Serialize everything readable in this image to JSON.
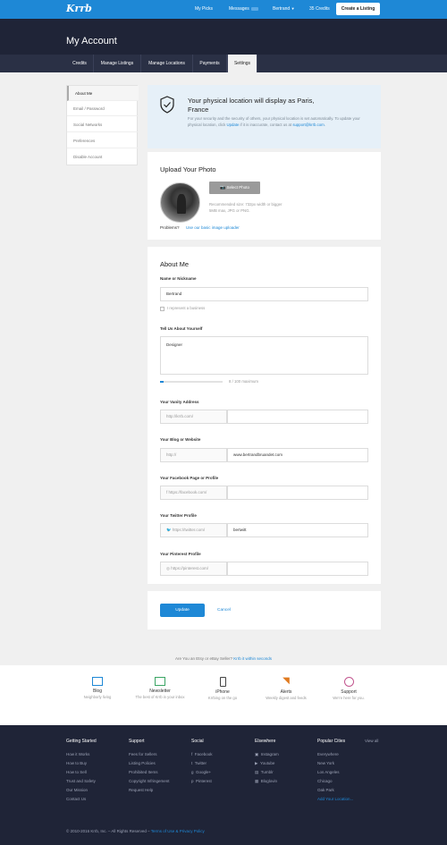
{
  "topbar": {
    "logo": "Krrb",
    "my_picks": "My Picks",
    "messages": "Messages",
    "user": "Bertrand",
    "credits": "35 Credits",
    "create_listing": "Create a Listing"
  },
  "header": {
    "title": "My Account"
  },
  "tabs": [
    "Credits",
    "Manage Listings",
    "Manage Locations",
    "Payments",
    "Settings"
  ],
  "sidebar": [
    "About Me",
    "Email / Password",
    "Social Networks",
    "Preferences",
    "Disable Account"
  ],
  "location": {
    "title": "Your physical location will display as Paris, France",
    "text": "For your security and the security of others, your physical location is set automatically. To update your physical location, click",
    "update_link": "Update",
    "text2": "if it is inaccurate, contact us at",
    "email": "support@krrb.com",
    "end": "."
  },
  "photo": {
    "heading": "Upload Your Photo",
    "select_btn": "Select Photo",
    "hint1": "Recommended size: 732px width or bigger",
    "hint2": "5MB max, JPG or PNG.",
    "problems": "Problems?",
    "basic_uploader": "Use our basic image uploader"
  },
  "about": {
    "heading": "About Me",
    "name_label": "Name or Nickname",
    "name_value": "Bertrand",
    "business_label": "I represent a business",
    "tell_label": "Tell Us About Yourself",
    "tell_value": "Designer",
    "counter": "8 / 100 maximum",
    "vanity_label": "Your Vanity Address",
    "vanity_prefix": "http://krrb.com/",
    "blog_label": "Your Blog or Website",
    "blog_prefix": "http://",
    "blog_value": "www.bertrandbruandet.com",
    "facebook_label": "Your Facebook Page or Profile",
    "facebook_prefix": "https://facebook.com/",
    "twitter_label": "Your Twitter Profile",
    "twitter_prefix": "https://twitter.com/",
    "twitter_value": "bertwitt",
    "pinterest_label": "Your Pinterest Profile",
    "pinterest_prefix": "https://pinterest.com/",
    "update_btn": "Update",
    "cancel": "Cancel"
  },
  "promo": {
    "text": "Are You an Etsy or eBay Seller?",
    "link": "Krrb it within seconds"
  },
  "features": [
    {
      "title": "Blog",
      "sub": "Neighborly living",
      "color": "#1e88d6"
    },
    {
      "title": "Newsletter",
      "sub": "The best of Krrb in your inbox",
      "color": "#3aa564"
    },
    {
      "title": "iPhone",
      "sub": "Krrbing on the go",
      "color": "#444444"
    },
    {
      "title": "Alerts",
      "sub": "Weekly digest and feeds",
      "color": "#e07a1f"
    },
    {
      "title": "Support",
      "sub": "We're here for you.",
      "color": "#c2568f"
    }
  ],
  "footer": {
    "getting_started": {
      "title": "Getting Started",
      "items": [
        "How it Works",
        "How to Buy",
        "How to Sell",
        "Trust and Safety",
        "Our Mission",
        "Contact Us"
      ]
    },
    "support": {
      "title": "Support",
      "items": [
        "Fees for Sellers",
        "Listing Policies",
        "Prohibited Items",
        "Copyright Infringement",
        "Request Help"
      ]
    },
    "social": {
      "title": "Social",
      "items": [
        "Facebook",
        "Twitter",
        "Google+",
        "Pinterest"
      ]
    },
    "elsewhere": {
      "title": "Elsewhere",
      "items": [
        "Instagram",
        "Youtube",
        "Tumblr",
        "Bloglovin"
      ]
    },
    "cities": {
      "title": "Popular Cities",
      "view_all": "View all",
      "items": [
        "Everywhere",
        "New York",
        "Los Angeles",
        "Chicago",
        "Oak Park"
      ],
      "add": "Add Your Location..."
    },
    "copyright": "© 2010-2016 Krrb, Inc. – All Rights Reserved –",
    "terms": "Terms of Use & Privacy Policy"
  }
}
